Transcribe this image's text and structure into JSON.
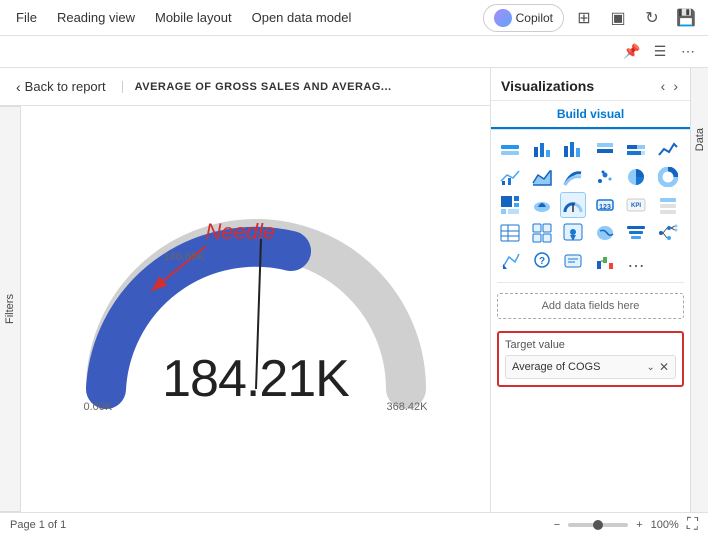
{
  "menu": {
    "file_label": "File",
    "reading_view_label": "Reading view",
    "mobile_layout_label": "Mobile layout",
    "open_data_model_label": "Open data model",
    "copilot_label": "Copilot"
  },
  "toolbar": {
    "icons": [
      "📌",
      "☰",
      "⋯"
    ]
  },
  "report": {
    "back_label": "Back to report",
    "title": "AVERAGE OF GROSS SALES AND AVERAG..."
  },
  "gauge": {
    "value": "184.21K",
    "min": "0.00K",
    "max": "368.42K",
    "needle_value": "146.65K",
    "needle_label": "Needle"
  },
  "viz_panel": {
    "title": "Visualizations",
    "build_visual_tab": "Build visual",
    "add_data_label": "Add data fields here",
    "target_section": {
      "label": "Target value",
      "field_value": "Average of COGS"
    }
  },
  "data_tab": {
    "label": "Data"
  },
  "filters_tab": {
    "label": "Filters"
  },
  "status_bar": {
    "page_label": "Page 1 of 1",
    "zoom_label": "100%"
  }
}
